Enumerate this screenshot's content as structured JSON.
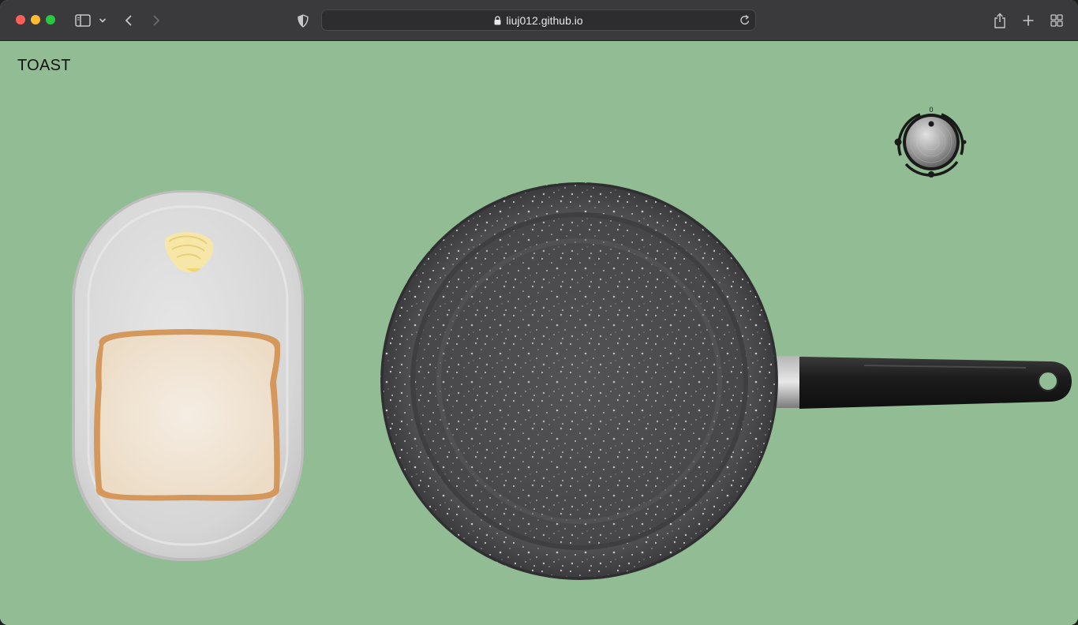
{
  "browser": {
    "url": "liuj012.github.io"
  },
  "page": {
    "title": "TOAST"
  },
  "stove_knob": {
    "label": "0"
  },
  "icons": {
    "sidebar": "sidebar-icon",
    "back": "chevron-left-icon",
    "forward": "chevron-right-icon",
    "shield": "shield-icon",
    "lock": "lock-icon",
    "reload": "reload-icon",
    "share": "share-icon",
    "new_tab": "plus-icon",
    "tabs": "tab-grid-icon"
  },
  "colors": {
    "background": "#92bc94",
    "pan": "#4a4a4c",
    "plate": "#dcdcdc",
    "bread": "#f3e8da",
    "crust": "#d2965a"
  }
}
